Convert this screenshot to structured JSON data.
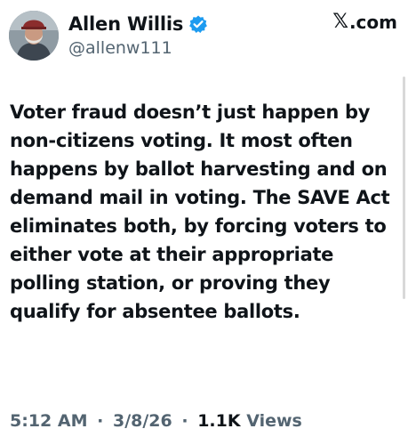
{
  "author": {
    "display_name": "Allen Willis",
    "handle": "@allenw111",
    "verified": true,
    "avatar_icon": "avatar-photo-icon",
    "verified_icon": "verified-badge-icon",
    "verified_color": "#1d9bf0"
  },
  "source": {
    "label": ".com",
    "logo_icon": "x-logo-icon"
  },
  "tweet": {
    "text": "Voter fraud doesn’t just happen by non-citizens voting. It most often happens by ballot harvesting and on demand mail in voting. The SAVE Act eliminates both, by forcing voters to either vote at their appropriate polling station, or proving they qualify for absentee ballots."
  },
  "meta": {
    "time": "5:12 AM",
    "separator": "·",
    "date": "3/8/26",
    "views_count": "1.1K",
    "views_label": "Views"
  },
  "colors": {
    "text_primary": "#0f1419",
    "text_secondary": "#536471"
  }
}
